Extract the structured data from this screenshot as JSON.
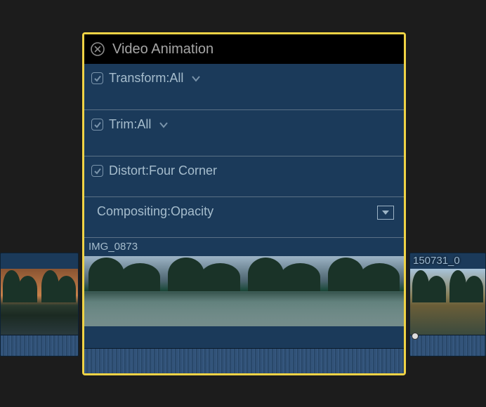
{
  "panel": {
    "title": "Video Animation",
    "rows": [
      {
        "label": "Transform:All",
        "checked": true,
        "chevron": true
      },
      {
        "label": "Trim:All",
        "checked": true,
        "chevron": true
      },
      {
        "label": "Distort:Four Corner",
        "checked": true,
        "chevron": false
      },
      {
        "label": "Compositing:Opacity",
        "checked": null,
        "chevron": false,
        "expand": true
      }
    ]
  },
  "clips": {
    "center_label": "IMG_0873",
    "right_label": "150731_0"
  }
}
